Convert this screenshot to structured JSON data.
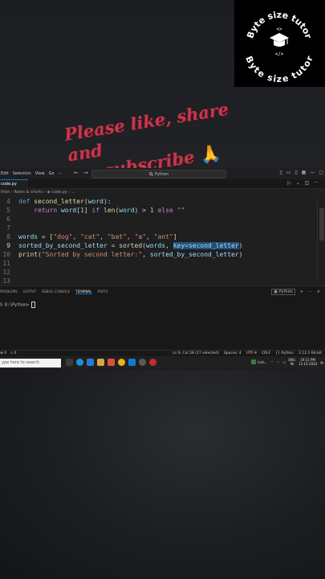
{
  "watermark": {
    "line1": "Byte size tutor",
    "line2": "Byte size tutor",
    "tag_top": "<>",
    "tag_bottom": "</>"
  },
  "overlay": {
    "line1": "Please like, share and",
    "line2": "subscribe",
    "emoji": "🙏"
  },
  "titlebar": {
    "menu": [
      "Edit",
      "Selection",
      "View",
      "Go",
      "···"
    ],
    "back": "←",
    "forward": "→",
    "search": "Python"
  },
  "tab": {
    "label": "code.py"
  },
  "breadcrumb": {
    "path": "thon › Reels & shorts ›",
    "file": "code.py › ..."
  },
  "code": {
    "lines": [
      {
        "n": "4",
        "tokens": [
          {
            "t": "def ",
            "c": "kw"
          },
          {
            "t": "second_letter",
            "c": "fn"
          },
          {
            "t": "(",
            "c": ""
          },
          {
            "t": "word",
            "c": "var"
          },
          {
            "t": "):",
            "c": ""
          }
        ]
      },
      {
        "n": "5",
        "tokens": [
          {
            "t": "    ",
            "c": ""
          },
          {
            "t": "return ",
            "c": "kw2"
          },
          {
            "t": "word",
            "c": "var"
          },
          {
            "t": "[",
            "c": ""
          },
          {
            "t": "1",
            "c": "num"
          },
          {
            "t": "] ",
            "c": ""
          },
          {
            "t": "if ",
            "c": "kw2"
          },
          {
            "t": "len",
            "c": "fn"
          },
          {
            "t": "(",
            "c": ""
          },
          {
            "t": "word",
            "c": "var"
          },
          {
            "t": ") > ",
            "c": ""
          },
          {
            "t": "1",
            "c": "num"
          },
          {
            "t": " ",
            "c": ""
          },
          {
            "t": "else ",
            "c": "kw2"
          },
          {
            "t": "\"\"",
            "c": "str"
          }
        ]
      },
      {
        "n": "6",
        "tokens": []
      },
      {
        "n": "7",
        "tokens": []
      },
      {
        "n": "8",
        "tokens": [
          {
            "t": "words",
            "c": "var"
          },
          {
            "t": " = [",
            "c": ""
          },
          {
            "t": "\"dog\"",
            "c": "str"
          },
          {
            "t": ", ",
            "c": ""
          },
          {
            "t": "\"cat\"",
            "c": "str"
          },
          {
            "t": ", ",
            "c": ""
          },
          {
            "t": "\"bat\"",
            "c": "str"
          },
          {
            "t": ", ",
            "c": ""
          },
          {
            "t": "\"a\"",
            "c": "str"
          },
          {
            "t": ", ",
            "c": ""
          },
          {
            "t": "\"ant\"",
            "c": "str"
          },
          {
            "t": "]",
            "c": ""
          }
        ]
      },
      {
        "n": "9",
        "active": true,
        "tokens": [
          {
            "t": "sorted_by_second_letter",
            "c": "var"
          },
          {
            "t": " = ",
            "c": ""
          },
          {
            "t": "sorted",
            "c": "fn"
          },
          {
            "t": "(",
            "c": ""
          },
          {
            "t": "words",
            "c": "var"
          },
          {
            "t": ", ",
            "c": ""
          },
          {
            "t": "key=second_letter",
            "c": "var sel"
          },
          {
            "t": ")",
            "c": ""
          }
        ]
      },
      {
        "n": "10",
        "tokens": [
          {
            "t": "print",
            "c": "fn"
          },
          {
            "t": "(",
            "c": ""
          },
          {
            "t": "\"Sorted by second letter:\"",
            "c": "str"
          },
          {
            "t": ", ",
            "c": ""
          },
          {
            "t": "sorted_by_second_letter",
            "c": "var"
          },
          {
            "t": ")",
            "c": ""
          }
        ]
      },
      {
        "n": "11",
        "tokens": []
      },
      {
        "n": "12",
        "tokens": []
      },
      {
        "n": "13",
        "tokens": []
      }
    ]
  },
  "panel": {
    "tabs": [
      "PROBLEMS",
      "OUTPUT",
      "DEBUG CONSOLE",
      "TERMINAL",
      "PORTS"
    ],
    "active_tab": "TERMINAL",
    "shell": "Python",
    "add": "+",
    "more": "···",
    "close": "×",
    "terminal_prompt": "S D:\\Python> "
  },
  "statusbar": {
    "errors": "0",
    "warnings": "0",
    "right": [
      "Ln 9, Col 58 (17 selected)",
      "Spaces: 4",
      "UTF-8",
      "CRLF",
      "{} Python",
      "3.12.1 64-bit"
    ]
  },
  "taskbar": {
    "search_placeholder": "ype here to search",
    "app_label": "Inch...",
    "language": "ENG",
    "region": "IN",
    "time": "19:11 PM",
    "date": "12-12-2024"
  }
}
